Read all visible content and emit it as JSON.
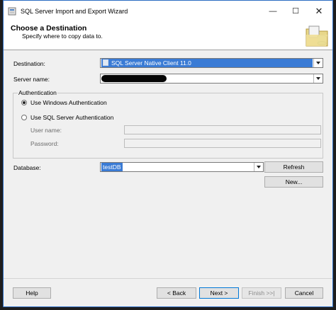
{
  "window": {
    "title": "SQL Server Import and Export Wizard"
  },
  "titlebar_controls": {
    "minimize": "—",
    "maximize": "☐",
    "close": "✕"
  },
  "header": {
    "title": "Choose a Destination",
    "subtitle": "Specify where to copy data to."
  },
  "form": {
    "destination_label": "Destination:",
    "destination_value": "SQL Server Native Client 11.0",
    "server_label": "Server name:",
    "server_value_redacted": true,
    "auth_group_title": "Authentication",
    "windows_auth_label": "Use Windows Authentication",
    "windows_auth_selected": true,
    "sql_auth_label": "Use SQL Server Authentication",
    "sql_auth_selected": false,
    "username_label": "User name:",
    "password_label": "Password:",
    "database_label": "Database:",
    "database_value": "testDB",
    "refresh_label": "Refresh",
    "new_label": "New..."
  },
  "footer": {
    "help_label": "Help",
    "back_label": "< Back",
    "next_label": "Next >",
    "finish_label": "Finish >>|",
    "cancel_label": "Cancel"
  },
  "colors": {
    "accent": "#0078d7",
    "selection": "#3a7bd5",
    "window_border": "#2b6cc2"
  }
}
